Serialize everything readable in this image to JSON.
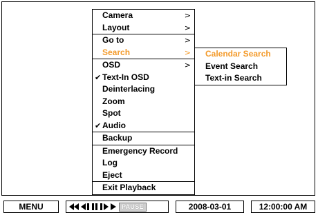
{
  "menu": {
    "groups": [
      {
        "items": [
          {
            "label": "Camera",
            "arrow": ">"
          },
          {
            "label": "Layout",
            "arrow": ">"
          }
        ]
      },
      {
        "items": [
          {
            "label": "Go to",
            "arrow": ">"
          },
          {
            "label": "Search",
            "arrow": ">",
            "active": true
          }
        ]
      },
      {
        "items": [
          {
            "label": "OSD",
            "arrow": ">"
          },
          {
            "label": "Text-In OSD",
            "checked": true
          },
          {
            "label": "Deinterlacing"
          },
          {
            "label": "Zoom"
          },
          {
            "label": "Spot"
          },
          {
            "label": "Audio",
            "checked": true
          }
        ]
      },
      {
        "items": [
          {
            "label": "Backup"
          }
        ]
      },
      {
        "items": [
          {
            "label": "Emergency Record"
          },
          {
            "label": "Log"
          },
          {
            "label": "Eject"
          }
        ]
      },
      {
        "items": [
          {
            "label": "Exit Playback"
          }
        ]
      }
    ],
    "check_glyph": "✔",
    "arrow_glyph": ">"
  },
  "submenu": {
    "items": [
      {
        "label": "Calendar Search",
        "active": true
      },
      {
        "label": "Event Search"
      },
      {
        "label": "Text-in Search"
      }
    ]
  },
  "statusbar": {
    "menu_label": "MENU",
    "transport_icons": [
      "fast-rewind-icon",
      "step-back-icon",
      "pause-icon",
      "step-forward-icon",
      "play-icon"
    ],
    "pause_badge": "PAUSE",
    "date": "2008-03-01",
    "time": "12:00:00 AM"
  },
  "colors": {
    "highlight": "#f39a2a",
    "badge_bg": "#d0d0d0"
  }
}
